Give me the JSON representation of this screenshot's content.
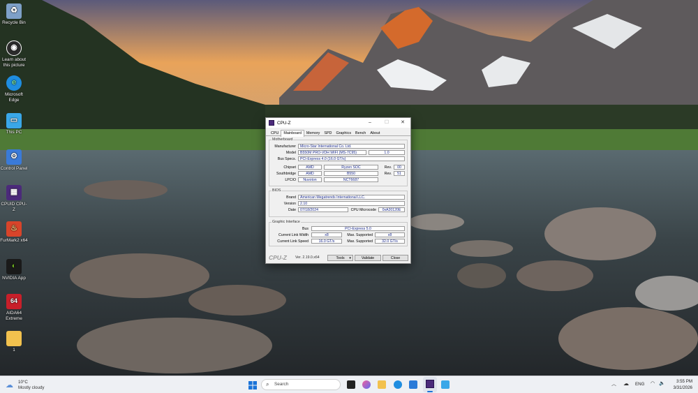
{
  "desktop": {
    "icons": [
      {
        "label": "Recycle Bin",
        "icon": "recycle-bin-icon",
        "color": "#7ea0c8"
      },
      {
        "label": "Learn about this picture",
        "icon": "camera-icon",
        "color": "#2b2b2b"
      },
      {
        "label": "Microsoft Edge",
        "icon": "edge-icon",
        "color": "#1f8de0"
      },
      {
        "label": "This PC",
        "icon": "monitor-icon",
        "color": "#3aa7e8"
      },
      {
        "label": "Control Panel",
        "icon": "control-panel-icon",
        "color": "#3a7ad8"
      },
      {
        "label": "CPUID CPU-Z",
        "icon": "cpuz-icon",
        "color": "#4b2a7a"
      },
      {
        "label": "FurMark2 x64",
        "icon": "furmark-icon",
        "color": "#d8442a"
      },
      {
        "label": "NVIDIA App",
        "icon": "nvidia-icon",
        "color": "#6fb021"
      },
      {
        "label": "AIDA64 Extreme",
        "icon": "aida64-icon",
        "color": "#c81f2a"
      },
      {
        "label": "1",
        "icon": "folder-icon",
        "color": "#f2c14e"
      }
    ]
  },
  "cpuz": {
    "title": "CPU-Z",
    "minimize": "–",
    "maximize": "☐",
    "close": "✕",
    "tabs": [
      "CPU",
      "Mainboard",
      "Memory",
      "SPD",
      "Graphics",
      "Bench",
      "About"
    ],
    "active_tab": "Mainboard",
    "motherboard": {
      "group_title": "Motherboard",
      "manufacturer_label": "Manufacturer",
      "manufacturer": "Micro-Star International Co. Ltd.",
      "model_label": "Model",
      "model": "B550M PRO-VDH WIFI (MS-7C95)",
      "model_rev": "1.0",
      "bus_label": "Bus Specs.",
      "bus": "PCI-Express 4.0 (16.0 GT/s)",
      "chipset_label": "Chipset",
      "chipset_vendor": "AMD",
      "chipset_name": "Ryzen SOC",
      "chipset_rev_label": "Rev.",
      "chipset_rev": "00",
      "southbridge_label": "Southbridge",
      "southbridge_vendor": "AMD",
      "southbridge_name": "B550",
      "southbridge_rev_label": "Rev.",
      "southbridge_rev": "51",
      "lpcio_label": "LPCIO",
      "lpcio_vendor": "Nuvoton",
      "lpcio_name": "NCT6687"
    },
    "bios": {
      "group_title": "BIOS",
      "brand_label": "Brand",
      "brand": "American Megatrends International LLC.",
      "version_label": "Version",
      "version": "2.10",
      "date_label": "Date",
      "date": "07/18/2024",
      "microcode_label": "CPU Microcode",
      "microcode": "0xA20120E"
    },
    "graphic": {
      "group_title": "Graphic Interface",
      "bus_label": "Bus",
      "bus": "PCI-Express 5.0",
      "width_label": "Current Link Width",
      "width": "x8",
      "max_width_label": "Max. Supported",
      "max_width": "x8",
      "speed_label": "Current Link Speed",
      "speed": "16.0 GT/s",
      "max_speed_label": "Max. Supported",
      "max_speed": "32.0 GT/s"
    },
    "footer": {
      "brand": "CPU-Z",
      "version": "Ver. 2.19.0.x64",
      "tools": "Tools",
      "validate": "Validate",
      "close": "Close"
    }
  },
  "taskbar": {
    "weather_temp": "10°C",
    "weather_desc": "Mostly cloudy",
    "search_placeholder": "Search",
    "lang": "ENG",
    "time": "3:55 PM",
    "date": "3/31/2026"
  }
}
